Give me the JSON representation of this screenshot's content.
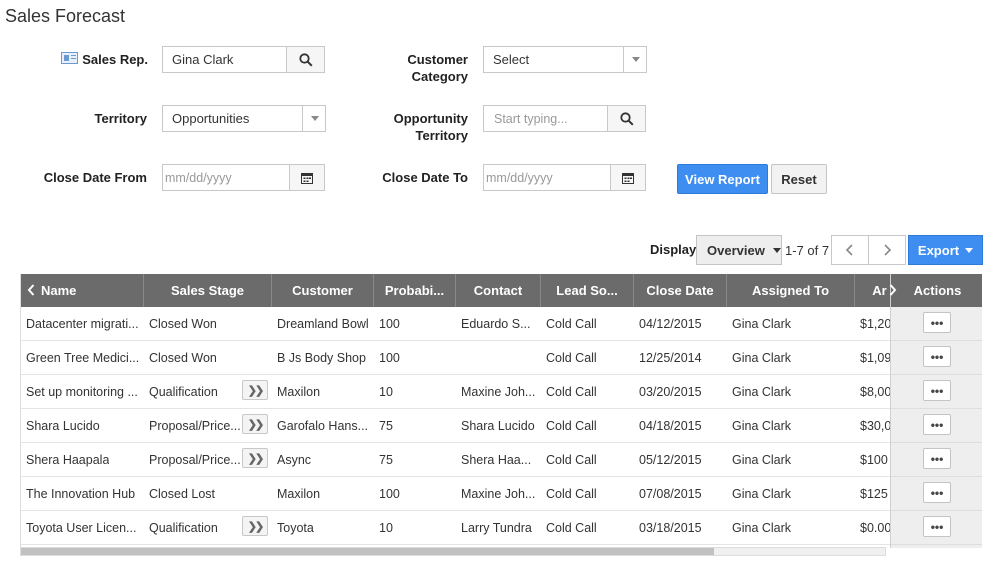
{
  "page": {
    "title": "Sales Forecast"
  },
  "filters": {
    "sales_rep": {
      "label": "Sales Rep.",
      "value": "Gina Clark"
    },
    "customer_category": {
      "label_line1": "Customer",
      "label_line2": "Category",
      "value": "Select"
    },
    "territory": {
      "label": "Territory",
      "value": "Opportunities"
    },
    "opportunity_territory": {
      "label_line1": "Opportunity",
      "label_line2": "Territory",
      "placeholder": "Start typing..."
    },
    "close_date_from": {
      "label": "Close Date From",
      "placeholder": "mm/dd/yyyy"
    },
    "close_date_to": {
      "label": "Close Date To",
      "placeholder": "mm/dd/yyyy"
    },
    "view_report_label": "View Report",
    "reset_label": "Reset"
  },
  "toolbar": {
    "display_label": "Display",
    "display_value": "Overview",
    "pager_text": "1-7 of 7",
    "export_label": "Export"
  },
  "grid": {
    "columns": [
      "Name",
      "Sales Stage",
      "Customer",
      "Probabi...",
      "Contact",
      "Lead So...",
      "Close Date",
      "Assigned To",
      "Ar",
      "Actions"
    ],
    "rows": [
      {
        "name": "Datacenter migrati...",
        "stage": "Closed Won",
        "customer": "Dreamland Bowl",
        "probability": "100",
        "contact": "Eduardo S...",
        "lead": "Cold Call",
        "close": "04/12/2015",
        "assigned": "Gina Clark",
        "amount": "$1,20"
      },
      {
        "name": "Green Tree Medici...",
        "stage": "Closed Won",
        "customer": "B Js Body Shop",
        "probability": "100",
        "contact": "",
        "lead": "Cold Call",
        "close": "12/25/2014",
        "assigned": "Gina Clark",
        "amount": "$1,09"
      },
      {
        "name": "Set up monitoring ...",
        "stage": "Qualification",
        "customer": "Maxilon",
        "probability": "10",
        "contact": "Maxine Joh...",
        "lead": "Cold Call",
        "close": "03/20/2015",
        "assigned": "Gina Clark",
        "amount": "$8,00"
      },
      {
        "name": "Shara Lucido",
        "stage": "Proposal/Price...",
        "customer": "Garofalo Hans...",
        "probability": "75",
        "contact": "Shara Lucido",
        "lead": "Cold Call",
        "close": "04/18/2015",
        "assigned": "Gina Clark",
        "amount": "$30,0"
      },
      {
        "name": "Shera Haapala",
        "stage": "Proposal/Price...",
        "customer": "Async",
        "probability": "75",
        "contact": "Shera Haa...",
        "lead": "Cold Call",
        "close": "05/12/2015",
        "assigned": "Gina Clark",
        "amount": "$100"
      },
      {
        "name": "The Innovation Hub",
        "stage": "Closed Lost",
        "customer": "Maxilon",
        "probability": "100",
        "contact": "Maxine Joh...",
        "lead": "Cold Call",
        "close": "07/08/2015",
        "assigned": "Gina Clark",
        "amount": "$125"
      },
      {
        "name": "Toyota User Licen...",
        "stage": "Qualification",
        "customer": "Toyota",
        "probability": "10",
        "contact": "Larry Tundra",
        "lead": "Cold Call",
        "close": "03/18/2015",
        "assigned": "Gina Clark",
        "amount": "$0.00"
      }
    ],
    "action_label": "•••",
    "expand_label": "❯❯"
  },
  "icons": {
    "search": "search-icon",
    "calendar": "calendar-icon",
    "contact_card": "contact-card-icon",
    "chevron_left": "chevron-left-icon",
    "chevron_right": "chevron-right-icon"
  },
  "colors": {
    "primary": "#3d8ef0",
    "grid_header": "#6b6b6b"
  }
}
